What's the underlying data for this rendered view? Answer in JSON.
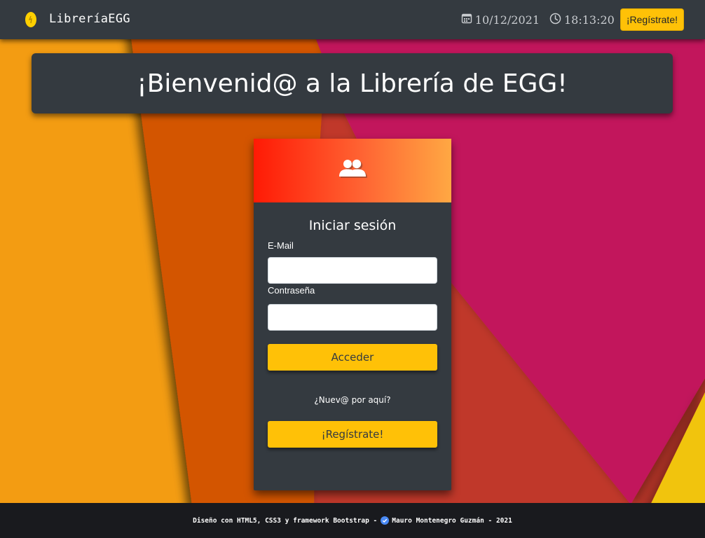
{
  "navbar": {
    "brand_name": "LibreríaEGG",
    "brand_icon": "egg-icon",
    "date": "10/12/2021",
    "date_icon": "calendar-icon",
    "time": "18:13:20",
    "time_icon": "clock-icon",
    "register_label": "¡Regístrate!"
  },
  "banner": {
    "title": "¡Bienvenid@ a la Librería de EGG!"
  },
  "login_card": {
    "header_icon": "users-icon",
    "title": "Iniciar sesión",
    "email_label": "E-Mail",
    "email_value": "",
    "password_label": "Contraseña",
    "password_value": "",
    "submit_label": "Acceder",
    "new_here_text": "¿Nuev@ por aquí?",
    "register_label": "¡Regístrate!"
  },
  "footer": {
    "text_before": "Diseño con HTML5, CSS3 y framework Bootstrap -",
    "icon": "verified-badge-icon",
    "text_after": "Mauro Montenegro Guzmán - 2021"
  },
  "colors": {
    "navbar_bg": "#343a40",
    "accent_yellow": "#ffc107",
    "footer_bg": "#191a1e",
    "gradient_start": "#ff1a05",
    "gradient_end": "#ffa843"
  }
}
